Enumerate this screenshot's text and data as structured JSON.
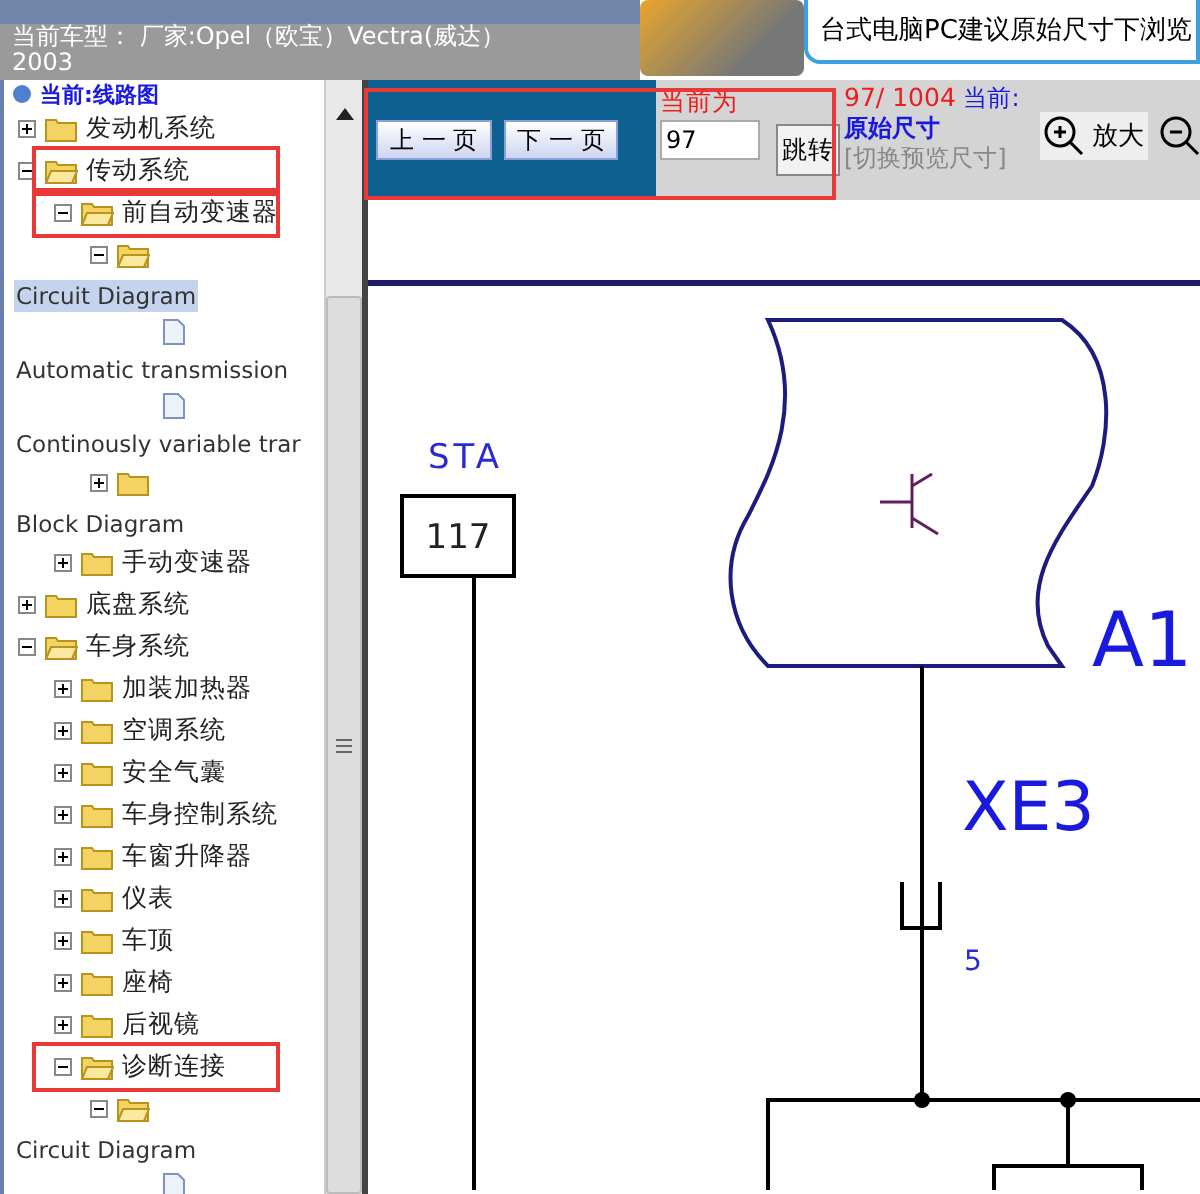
{
  "header": {
    "title": "当前车型： 厂家:Opel（欧宝）Vectra(威达）2003"
  },
  "banner": {
    "text": "台式电脑PC建议原始尺寸下浏览"
  },
  "tree": {
    "heading": "当前:线路图",
    "items": [
      {
        "kind": "folder",
        "label": "发动机系统",
        "expanded": false
      },
      {
        "kind": "folder",
        "label": "传动系统",
        "expanded": true,
        "annotated": true,
        "children": [
          {
            "kind": "folder",
            "label": "前自动变速器",
            "expanded": true,
            "annotated": true,
            "children": [
              {
                "kind": "folder",
                "expanded": true,
                "children": [
                  {
                    "kind": "caption",
                    "label": "Circuit Diagram",
                    "selected": true
                  },
                  {
                    "kind": "document"
                  },
                  {
                    "kind": "caption",
                    "label": "Automatic transmission",
                    "selected": false
                  },
                  {
                    "kind": "document"
                  },
                  {
                    "kind": "caption",
                    "label": "Continously variable trar",
                    "selected": false
                  }
                ]
              },
              {
                "kind": "folder",
                "expanded": false
              },
              {
                "kind": "caption",
                "label": "Block Diagram",
                "selected": false
              }
            ]
          },
          {
            "kind": "folder",
            "label": "手动变速器",
            "expanded": false
          }
        ]
      },
      {
        "kind": "folder",
        "label": "底盘系统",
        "expanded": false
      },
      {
        "kind": "folder",
        "label": "车身系统",
        "expanded": true,
        "children": [
          {
            "kind": "folder",
            "label": "加装加热器",
            "expanded": false
          },
          {
            "kind": "folder",
            "label": "空调系统",
            "expanded": false
          },
          {
            "kind": "folder",
            "label": "安全气囊",
            "expanded": false
          },
          {
            "kind": "folder",
            "label": "车身控制系统",
            "expanded": false
          },
          {
            "kind": "folder",
            "label": "车窗升降器",
            "expanded": false
          },
          {
            "kind": "folder",
            "label": "仪表",
            "expanded": false
          },
          {
            "kind": "folder",
            "label": "车顶",
            "expanded": false
          },
          {
            "kind": "folder",
            "label": "座椅",
            "expanded": false
          },
          {
            "kind": "folder",
            "label": "后视镜",
            "expanded": false
          },
          {
            "kind": "folder",
            "label": "诊断连接",
            "expanded": true,
            "annotated": true,
            "children": [
              {
                "kind": "folder",
                "expanded": true,
                "children": [
                  {
                    "kind": "caption",
                    "label": "Circuit Diagram",
                    "selected": false
                  },
                  {
                    "kind": "document"
                  }
                ]
              }
            ]
          }
        ]
      }
    ]
  },
  "toolbar": {
    "annotated": true,
    "prev_button": "上 一 页",
    "next_button": "下 一 页",
    "page_label": "当前为",
    "page_input": "97",
    "go_button": "跳转",
    "page_count": "97/ 1004",
    "size_status": "当前:**原始尺寸**",
    "size_toggle": "[切换预览尺寸]",
    "zoom_in": "放大"
  },
  "diagram": {
    "labels": [
      "STA",
      "117",
      "A1",
      "XE3",
      "5"
    ]
  }
}
